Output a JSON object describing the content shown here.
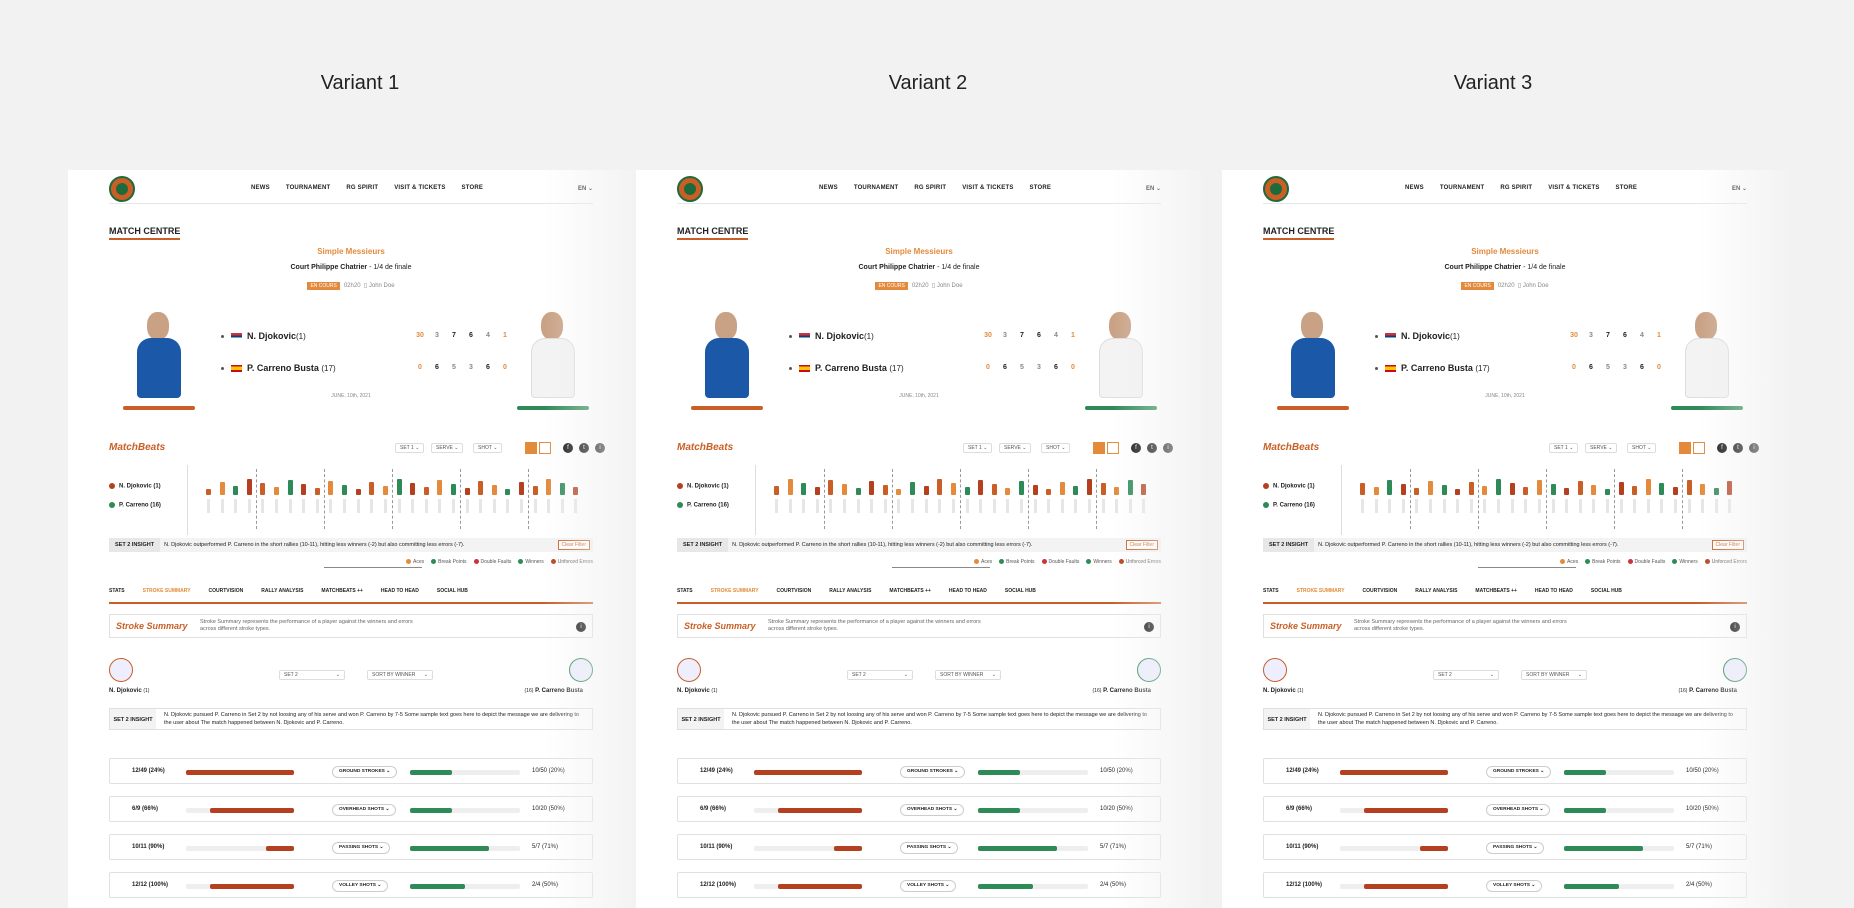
{
  "variants": [
    {
      "title": "Variant 1"
    },
    {
      "title": "Variant 2"
    },
    {
      "title": "Variant 3"
    }
  ],
  "nav": {
    "items": [
      "NEWS",
      "TOURNAMENT",
      "RG SPIRIT",
      "VISIT & TICKETS",
      "STORE"
    ],
    "lang": "EN"
  },
  "match_centre": {
    "title": "MATCH CENTRE",
    "competition": "Simple Messieurs",
    "court": "Court Philippe Chatrier",
    "round": "- 1/4 de finale",
    "status": "EN COURS",
    "duration": "02h20",
    "umpire": "John Doe",
    "date": "JUNE, 10th, 2021"
  },
  "players": [
    {
      "name": "N. Djokovic",
      "seed": "(1)",
      "scores": [
        "30",
        "3",
        "7",
        "6",
        "4",
        "1"
      ],
      "colors": {
        "shirt": "#1b58a8",
        "base": "#c95f26"
      }
    },
    {
      "name": "P. Carreno Busta",
      "seed": "(17)",
      "scores": [
        "0",
        "6",
        "5",
        "3",
        "6",
        "0"
      ],
      "colors": {
        "shirt": "#f3f3f3",
        "base": "#2e8a57"
      }
    }
  ],
  "matchbeats": {
    "logo": "MatchBeats",
    "filters": [
      "SET 1",
      "SERVE",
      "SHOT"
    ],
    "legend_players": [
      "N. Djokovic (1)",
      "P. Carreno (16)"
    ],
    "insight_tag": "SET 2 INSIGHT",
    "insight_text": "N. Djokovic outperformed P. Carreno in the short rallies (10-11), hitting less winners (-2) but also committing less errors (-7).",
    "clear_filter": "Clear Filter",
    "legend": [
      "Aces",
      "Break Points",
      "Double Faults",
      "Winners",
      "Unforced Errors"
    ]
  },
  "tabs": [
    "STATS",
    "STROKE SUMMARY",
    "COURTVISION",
    "RALLY ANALYSIS",
    "MATCHBEATS ++",
    "HEAD TO HEAD",
    "SOCIAL HUB"
  ],
  "stroke_summary": {
    "logo": "Stroke Summary",
    "description": "Stroke Summary represents the performance of a player against the winners and errors across different stroke types.",
    "left_player": "N. Djokovic",
    "left_seed": "(1)",
    "right_player": "P. Carreno Busta",
    "right_seed": "(16)",
    "set_filter": "SET 2",
    "sort_filter": "SORT BY WINNER",
    "insight_tag": "SET 2 INSIGHT",
    "insight_text": "N. Djokovic pursued P. Carreno in Set 2 by not loosing any of his serve and won P. Carreno by 7-5 Some sample text goes here to depict the message we are delivering to the user about The match happened between N. Djokovic and P. Carreno.",
    "rows": [
      {
        "left": "12/49 (24%)",
        "left_pct": 100,
        "label": "GROUND STROKES",
        "right": "10/50 (20%)",
        "right_pct": 38
      },
      {
        "left": "6/9 (66%)",
        "left_pct": 78,
        "label": "OVERHEAD SHOTS",
        "right": "10/20 (50%)",
        "right_pct": 38
      },
      {
        "left": "10/11 (90%)",
        "left_pct": 26,
        "label": "PASSING SHOTS",
        "right": "5/7 (71%)",
        "right_pct": 72
      },
      {
        "left": "12/12 (100%)",
        "left_pct": 78,
        "label": "VOLLEY SHOTS",
        "right": "2/4 (50%)",
        "right_pct": 50
      }
    ]
  }
}
